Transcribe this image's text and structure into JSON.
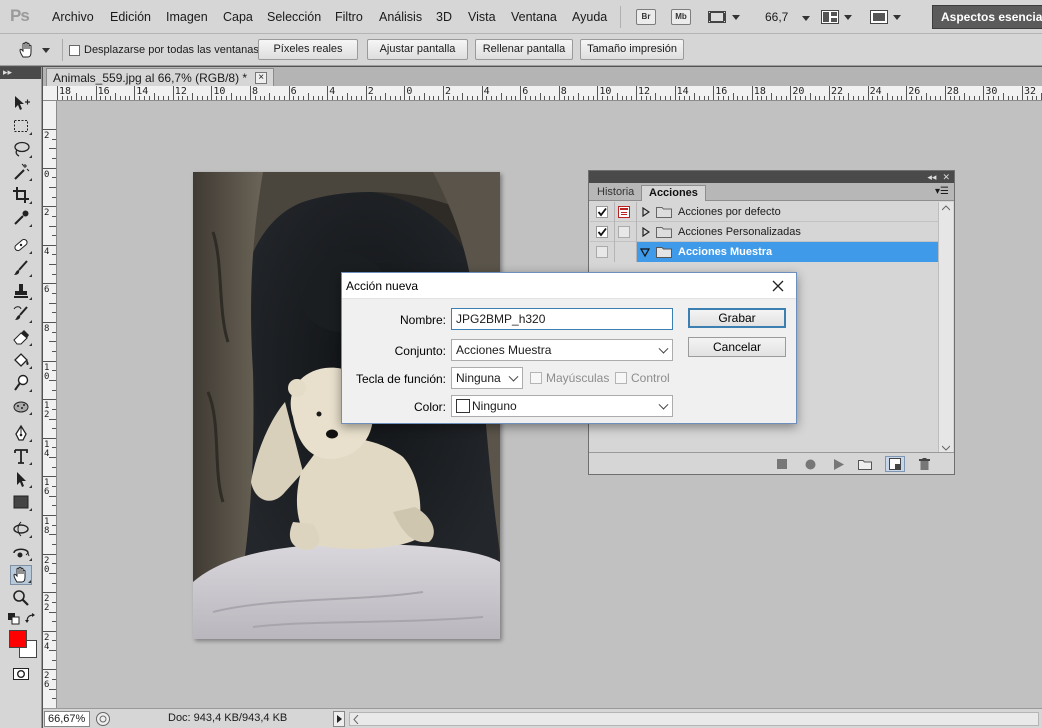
{
  "app": {
    "logo": "Ps"
  },
  "menubar": {
    "items": [
      "Archivo",
      "Edición",
      "Imagen",
      "Capa",
      "Selección",
      "Filtro",
      "Análisis",
      "3D",
      "Vista",
      "Ventana",
      "Ayuda"
    ],
    "bridge_label": "Br",
    "minibridge_label": "Mb",
    "zoom": "66,7",
    "workspace": "Aspectos esenciales"
  },
  "options": {
    "scroll_all_label": "Desplazarse por todas las ventanas",
    "buttons": [
      "Píxeles reales",
      "Ajustar pantalla",
      "Rellenar pantalla",
      "Tamaño impresión"
    ]
  },
  "document": {
    "tab_title": "Animals_559.jpg al 66,7% (RGB/8) *",
    "close_glyph": "×"
  },
  "ruler": {
    "h_labels": [
      "18",
      "16",
      "14",
      "12",
      "10",
      "8",
      "6",
      "4",
      "2",
      "0",
      "2",
      "4",
      "6",
      "8",
      "10",
      "12",
      "14",
      "16",
      "18",
      "20",
      "22",
      "24",
      "26",
      "28",
      "30",
      "32"
    ],
    "v_labels": [
      "2",
      "0",
      "2",
      "4",
      "6",
      "8",
      "1\n0",
      "1\n2",
      "1\n4",
      "1\n6",
      "1\n8",
      "2\n0",
      "2\n2",
      "2\n4",
      "2\n6"
    ]
  },
  "actions_panel": {
    "tabs": [
      "Historia",
      "Acciones"
    ],
    "active_tab": "Acciones",
    "sets": [
      {
        "name": "Acciones por defecto",
        "checked": true,
        "dialog": true,
        "expanded": false,
        "selected": false
      },
      {
        "name": "Acciones Personalizadas",
        "checked": true,
        "dialog": false,
        "expanded": false,
        "selected": false
      },
      {
        "name": "Acciones Muestra",
        "checked": false,
        "dialog": false,
        "expanded": true,
        "selected": true
      }
    ],
    "selection_color": "#3f9ae9"
  },
  "dialog": {
    "title": "Acción nueva",
    "name_label": "Nombre:",
    "name_value": "JPG2BMP_h320",
    "set_label": "Conjunto:",
    "set_value": "Acciones Muestra",
    "fkey_label": "Tecla de función:",
    "fkey_value": "Ninguna",
    "shift_label": "Mayúsculas",
    "control_label": "Control",
    "color_label": "Color:",
    "color_value": "Ninguno",
    "record_button": "Grabar",
    "cancel_button": "Cancelar"
  },
  "status": {
    "zoom": "66,67%",
    "doc_info": "Doc: 943,4 KB/943,4 KB"
  },
  "colors": {
    "foreground": "#ff0000",
    "background": "#ffffff"
  }
}
